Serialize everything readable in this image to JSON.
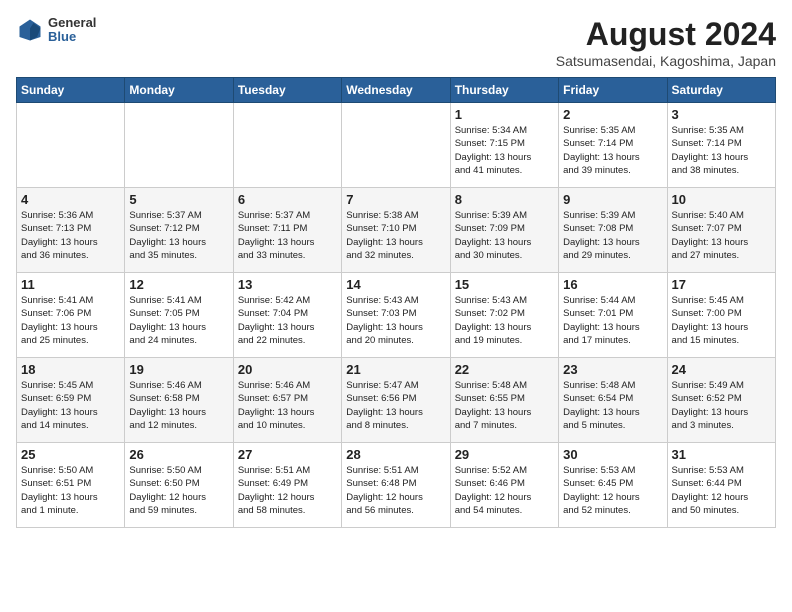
{
  "logo": {
    "general": "General",
    "blue": "Blue"
  },
  "title": "August 2024",
  "location": "Satsumasendai, Kagoshima, Japan",
  "days_of_week": [
    "Sunday",
    "Monday",
    "Tuesday",
    "Wednesday",
    "Thursday",
    "Friday",
    "Saturday"
  ],
  "weeks": [
    [
      {
        "day": "",
        "info": ""
      },
      {
        "day": "",
        "info": ""
      },
      {
        "day": "",
        "info": ""
      },
      {
        "day": "",
        "info": ""
      },
      {
        "day": "1",
        "info": "Sunrise: 5:34 AM\nSunset: 7:15 PM\nDaylight: 13 hours\nand 41 minutes."
      },
      {
        "day": "2",
        "info": "Sunrise: 5:35 AM\nSunset: 7:14 PM\nDaylight: 13 hours\nand 39 minutes."
      },
      {
        "day": "3",
        "info": "Sunrise: 5:35 AM\nSunset: 7:14 PM\nDaylight: 13 hours\nand 38 minutes."
      }
    ],
    [
      {
        "day": "4",
        "info": "Sunrise: 5:36 AM\nSunset: 7:13 PM\nDaylight: 13 hours\nand 36 minutes."
      },
      {
        "day": "5",
        "info": "Sunrise: 5:37 AM\nSunset: 7:12 PM\nDaylight: 13 hours\nand 35 minutes."
      },
      {
        "day": "6",
        "info": "Sunrise: 5:37 AM\nSunset: 7:11 PM\nDaylight: 13 hours\nand 33 minutes."
      },
      {
        "day": "7",
        "info": "Sunrise: 5:38 AM\nSunset: 7:10 PM\nDaylight: 13 hours\nand 32 minutes."
      },
      {
        "day": "8",
        "info": "Sunrise: 5:39 AM\nSunset: 7:09 PM\nDaylight: 13 hours\nand 30 minutes."
      },
      {
        "day": "9",
        "info": "Sunrise: 5:39 AM\nSunset: 7:08 PM\nDaylight: 13 hours\nand 29 minutes."
      },
      {
        "day": "10",
        "info": "Sunrise: 5:40 AM\nSunset: 7:07 PM\nDaylight: 13 hours\nand 27 minutes."
      }
    ],
    [
      {
        "day": "11",
        "info": "Sunrise: 5:41 AM\nSunset: 7:06 PM\nDaylight: 13 hours\nand 25 minutes."
      },
      {
        "day": "12",
        "info": "Sunrise: 5:41 AM\nSunset: 7:05 PM\nDaylight: 13 hours\nand 24 minutes."
      },
      {
        "day": "13",
        "info": "Sunrise: 5:42 AM\nSunset: 7:04 PM\nDaylight: 13 hours\nand 22 minutes."
      },
      {
        "day": "14",
        "info": "Sunrise: 5:43 AM\nSunset: 7:03 PM\nDaylight: 13 hours\nand 20 minutes."
      },
      {
        "day": "15",
        "info": "Sunrise: 5:43 AM\nSunset: 7:02 PM\nDaylight: 13 hours\nand 19 minutes."
      },
      {
        "day": "16",
        "info": "Sunrise: 5:44 AM\nSunset: 7:01 PM\nDaylight: 13 hours\nand 17 minutes."
      },
      {
        "day": "17",
        "info": "Sunrise: 5:45 AM\nSunset: 7:00 PM\nDaylight: 13 hours\nand 15 minutes."
      }
    ],
    [
      {
        "day": "18",
        "info": "Sunrise: 5:45 AM\nSunset: 6:59 PM\nDaylight: 13 hours\nand 14 minutes."
      },
      {
        "day": "19",
        "info": "Sunrise: 5:46 AM\nSunset: 6:58 PM\nDaylight: 13 hours\nand 12 minutes."
      },
      {
        "day": "20",
        "info": "Sunrise: 5:46 AM\nSunset: 6:57 PM\nDaylight: 13 hours\nand 10 minutes."
      },
      {
        "day": "21",
        "info": "Sunrise: 5:47 AM\nSunset: 6:56 PM\nDaylight: 13 hours\nand 8 minutes."
      },
      {
        "day": "22",
        "info": "Sunrise: 5:48 AM\nSunset: 6:55 PM\nDaylight: 13 hours\nand 7 minutes."
      },
      {
        "day": "23",
        "info": "Sunrise: 5:48 AM\nSunset: 6:54 PM\nDaylight: 13 hours\nand 5 minutes."
      },
      {
        "day": "24",
        "info": "Sunrise: 5:49 AM\nSunset: 6:52 PM\nDaylight: 13 hours\nand 3 minutes."
      }
    ],
    [
      {
        "day": "25",
        "info": "Sunrise: 5:50 AM\nSunset: 6:51 PM\nDaylight: 13 hours\nand 1 minute."
      },
      {
        "day": "26",
        "info": "Sunrise: 5:50 AM\nSunset: 6:50 PM\nDaylight: 12 hours\nand 59 minutes."
      },
      {
        "day": "27",
        "info": "Sunrise: 5:51 AM\nSunset: 6:49 PM\nDaylight: 12 hours\nand 58 minutes."
      },
      {
        "day": "28",
        "info": "Sunrise: 5:51 AM\nSunset: 6:48 PM\nDaylight: 12 hours\nand 56 minutes."
      },
      {
        "day": "29",
        "info": "Sunrise: 5:52 AM\nSunset: 6:46 PM\nDaylight: 12 hours\nand 54 minutes."
      },
      {
        "day": "30",
        "info": "Sunrise: 5:53 AM\nSunset: 6:45 PM\nDaylight: 12 hours\nand 52 minutes."
      },
      {
        "day": "31",
        "info": "Sunrise: 5:53 AM\nSunset: 6:44 PM\nDaylight: 12 hours\nand 50 minutes."
      }
    ]
  ]
}
